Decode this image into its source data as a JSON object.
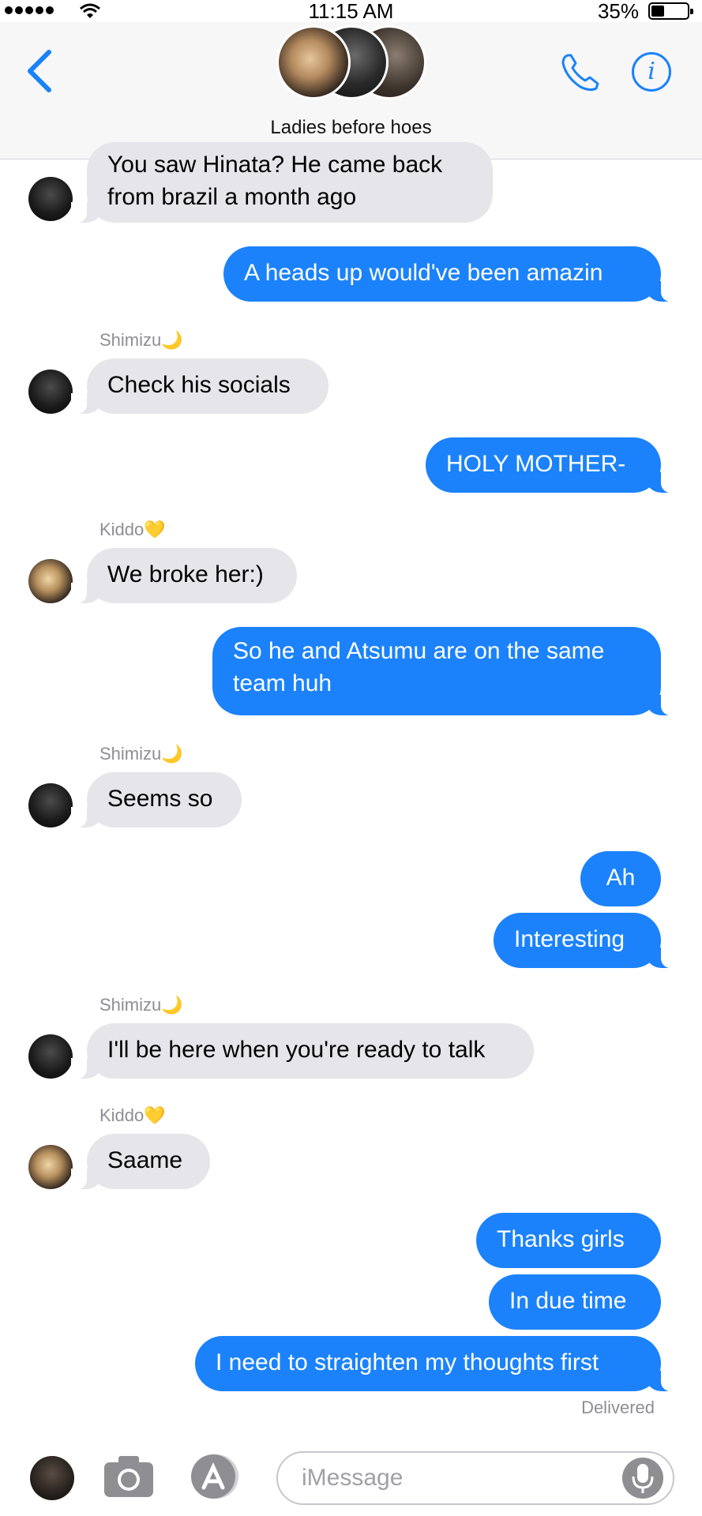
{
  "status_bar": {
    "time": "11:15 AM",
    "battery": "35%"
  },
  "header": {
    "group_name": "Ladies before hoes"
  },
  "messages": [
    {
      "text": "You saw Hinata? He came back",
      "text2": "from brazil a month ago"
    },
    {
      "text": "A heads up would've been amazin"
    },
    {
      "sender": "Shimizu",
      "sender_emoji": "🌙",
      "text": "Check his socials"
    },
    {
      "text": "HOLY MOTHER-"
    },
    {
      "sender": "Kiddo",
      "sender_emoji": "💛",
      "text": "We broke her:)"
    },
    {
      "text": "So he and Atsumu are on the same",
      "text2": "team huh"
    },
    {
      "sender": "Shimizu",
      "sender_emoji": "🌙",
      "text": "Seems so"
    },
    {
      "text": "Ah"
    },
    {
      "text": "Interesting"
    },
    {
      "sender": "Shimizu",
      "sender_emoji": "🌙",
      "text": "I'll be here when you're ready to talk"
    },
    {
      "sender": "Kiddo",
      "sender_emoji": "💛",
      "text": "Saame"
    },
    {
      "text": "Thanks girls"
    },
    {
      "text": "In due time"
    },
    {
      "text": "I need to straighten my thoughts first"
    }
  ],
  "delivered_label": "Delivered",
  "input": {
    "placeholder": "iMessage"
  },
  "colors": {
    "accent": "#1b82fb",
    "incoming_bubble": "#e5e5ea",
    "meta_text": "#8e8e93"
  },
  "icons": [
    "back-chevron-icon",
    "phone-icon",
    "info-icon",
    "camera-icon",
    "app-store-icon",
    "microphone-icon"
  ]
}
